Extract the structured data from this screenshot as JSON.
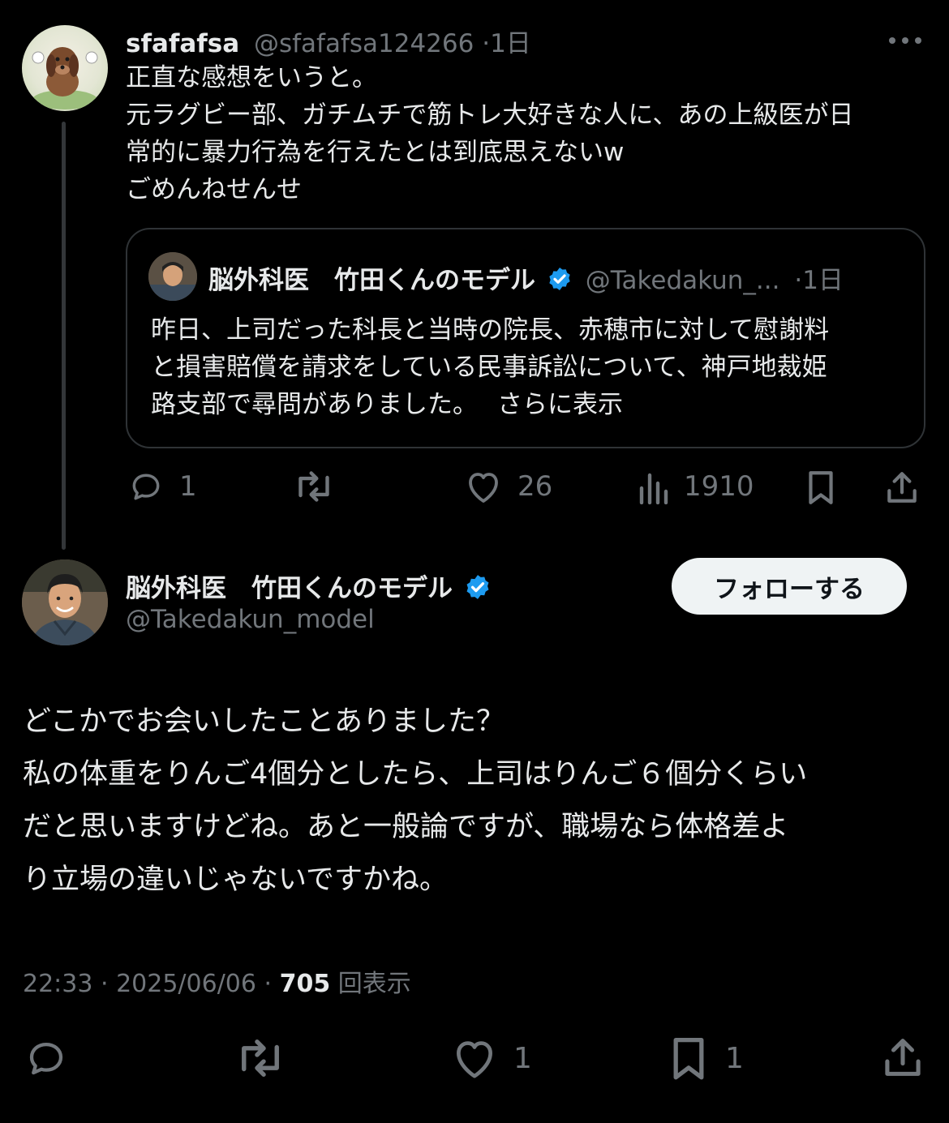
{
  "reply_post": {
    "author_name": "sfafafsa",
    "author_handle": "@sfafafsa124266",
    "time": "·1日",
    "lines": [
      "正直な感想をいうと。",
      "元ラグビー部、ガチムチで筋トレ大好きな人に、あの上級医が日",
      "常的に暴力行為を行えたとは到底思えないw",
      "ごめんねせんせ"
    ],
    "quote": {
      "author_name": "脳外科医　竹田くんのモデル",
      "author_handle": "@Takedakun_...",
      "time": "·1日",
      "lines": [
        "昨日、上司だった科長と当時の院長、赤穂市に対して慰謝料",
        "と損害賠償を請求をしている民事訴訟について、神戸地裁姫",
        "路支部で尋問がありました。"
      ],
      "show_more": "さらに表示"
    },
    "actions": {
      "replies": "1",
      "likes": "26",
      "views": "1910"
    }
  },
  "main_post": {
    "author_name": "脳外科医　竹田くんのモデル",
    "author_handle": "@Takedakun_model",
    "follow_label": "フォローする",
    "lines": [
      "どこかでお会いしたことありました？",
      "私の体重をりんご4個分としたら、上司はりんご６個分くらい",
      "だと思いますけどね。あと一般論ですが、職場なら体格差よ",
      "り立場の違いじゃないですかね。"
    ],
    "meta": {
      "time": "22:33 · 2025/06/06 · ",
      "views_count": "705",
      "views_label": "回表示"
    },
    "actions": {
      "likes": "1",
      "bookmarks": "1"
    }
  },
  "icons": {
    "more": "more-icon",
    "reply": "reply-icon",
    "repost": "repost-icon",
    "like": "like-icon",
    "views": "views-icon",
    "bookmark": "bookmark-icon",
    "share": "share-icon",
    "verified": "verified-badge-icon"
  },
  "colors": {
    "background": "#000000",
    "text": "#e7e9ea",
    "muted": "#71767b",
    "border": "#2f3336",
    "verified": "#1d9bf0"
  }
}
